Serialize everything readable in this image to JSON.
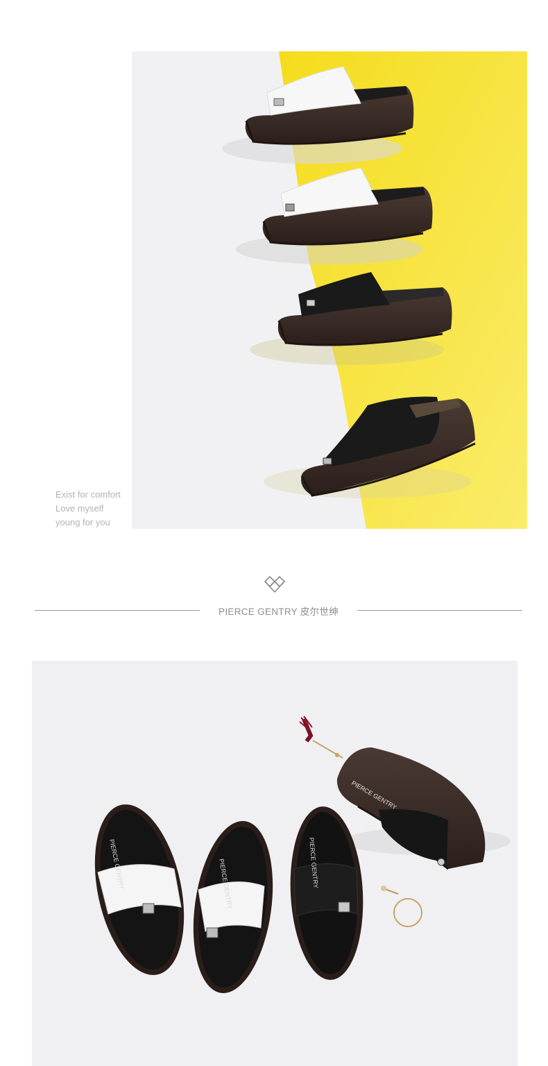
{
  "hero": {
    "tagline": [
      "Exist for comfort",
      "Love myself",
      "young for you"
    ],
    "colors": {
      "yellow": "#f7e22a",
      "sole": "#3a2a24",
      "white_leather": "#f4f4f4",
      "black_leather": "#1c1c1c"
    }
  },
  "brand": {
    "name": "PIERCE GENTRY 皮尔世绅",
    "logo_icon": "diamond-heart-logo-icon"
  },
  "flatlay": {
    "insole_brand": "PIERCE GENTRY"
  }
}
